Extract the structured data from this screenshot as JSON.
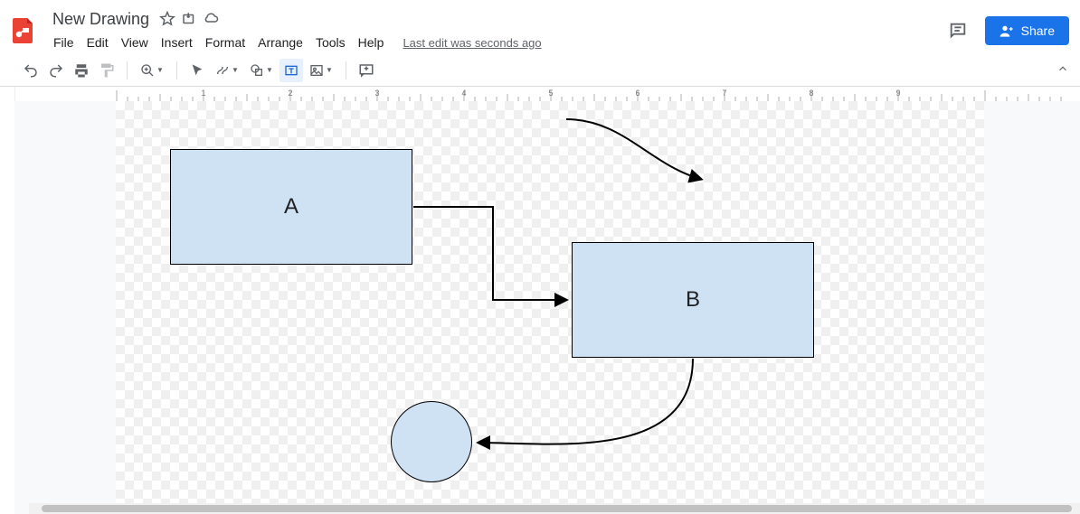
{
  "doc": {
    "title": "New Drawing"
  },
  "menus": {
    "file": "File",
    "edit": "Edit",
    "view": "View",
    "insert": "Insert",
    "format": "Format",
    "arrange": "Arrange",
    "tools": "Tools",
    "help": "Help"
  },
  "last_edit": "Last edit was seconds ago",
  "share_label": "Share",
  "ruler_labels": [
    "1",
    "2",
    "3",
    "4",
    "5",
    "6",
    "7",
    "8",
    "9"
  ],
  "shapes": {
    "rect_a": {
      "label": "A"
    },
    "rect_b": {
      "label": "B"
    }
  }
}
